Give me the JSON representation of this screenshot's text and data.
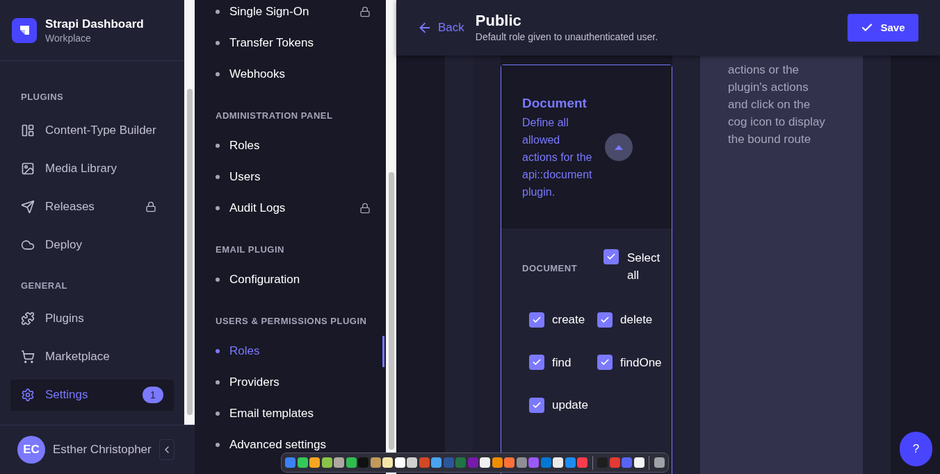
{
  "sidebar": {
    "brand": {
      "title": "Strapi Dashboard",
      "subtitle": "Workplace"
    },
    "sections": [
      {
        "heading": "PLUGINS",
        "items": [
          {
            "label": "Content-Type Builder",
            "selected": false,
            "locked": false
          },
          {
            "label": "Media Library",
            "selected": false,
            "locked": false
          },
          {
            "label": "Releases",
            "selected": false,
            "locked": true
          },
          {
            "label": "Deploy",
            "selected": false,
            "locked": false
          }
        ]
      },
      {
        "heading": "GENERAL",
        "items": [
          {
            "label": "Plugins",
            "selected": false,
            "locked": false
          },
          {
            "label": "Marketplace",
            "selected": false,
            "locked": false
          },
          {
            "label": "Settings",
            "selected": true,
            "locked": false,
            "badge": "1"
          }
        ]
      }
    ],
    "user": {
      "initials": "EC",
      "name": "Esther Christopher"
    }
  },
  "settings_nav": {
    "groups": [
      {
        "items": [
          {
            "label": "Single Sign-On",
            "selected": false,
            "locked": true
          },
          {
            "label": "Transfer Tokens",
            "selected": false,
            "locked": false
          },
          {
            "label": "Webhooks",
            "selected": false,
            "locked": false
          }
        ]
      },
      {
        "heading": "ADMINISTRATION PANEL",
        "items": [
          {
            "label": "Roles",
            "selected": false,
            "locked": false
          },
          {
            "label": "Users",
            "selected": false,
            "locked": false
          },
          {
            "label": "Audit Logs",
            "selected": false,
            "locked": true
          }
        ]
      },
      {
        "heading": "EMAIL PLUGIN",
        "items": [
          {
            "label": "Configuration",
            "selected": false,
            "locked": false
          }
        ]
      },
      {
        "heading": "USERS & PERMISSIONS PLUGIN",
        "items": [
          {
            "label": "Roles",
            "selected": true,
            "locked": false
          },
          {
            "label": "Providers",
            "selected": false,
            "locked": false
          },
          {
            "label": "Email templates",
            "selected": false,
            "locked": false
          },
          {
            "label": "Advanced settings",
            "selected": false,
            "locked": false
          }
        ]
      }
    ]
  },
  "header": {
    "back": "Back",
    "title": "Public",
    "subtitle": "Default role given to unauthenticated user.",
    "save": "Save"
  },
  "permissions_card": {
    "title": "Document",
    "description": "Define all allowed actions for the api::document plugin.",
    "expanded": true,
    "section_label": "DOCUMENT",
    "select_all": {
      "label": "Select all",
      "checked": true
    },
    "actions": [
      {
        "label": "create",
        "checked": true
      },
      {
        "label": "delete",
        "checked": true
      },
      {
        "label": "find",
        "checked": true
      },
      {
        "label": "findOne",
        "checked": true
      },
      {
        "label": "update",
        "checked": true
      }
    ]
  },
  "info_panel": {
    "text": "actions or the plugin's actions and click on the cog icon to display the bound route"
  },
  "help_button": "?",
  "dock": {
    "items": [
      {
        "kind": "app",
        "color": "#3b82f6"
      },
      {
        "kind": "app",
        "color": "#34c759"
      },
      {
        "kind": "app",
        "color": "#f5a623"
      },
      {
        "kind": "app",
        "color": "#8bc34a"
      },
      {
        "kind": "app",
        "color": "#b0a8a0"
      },
      {
        "kind": "app",
        "color": "#2fbf4f"
      },
      {
        "kind": "app",
        "color": "#111111"
      },
      {
        "kind": "app",
        "color": "#c19a5b"
      },
      {
        "kind": "app",
        "color": "#f5e6a8"
      },
      {
        "kind": "app",
        "color": "#ffffff"
      },
      {
        "kind": "app",
        "color": "#d0d0d0"
      },
      {
        "kind": "app",
        "color": "#d24726"
      },
      {
        "kind": "app",
        "color": "#4aa3f0"
      },
      {
        "kind": "app",
        "color": "#2b579a"
      },
      {
        "kind": "app",
        "color": "#217346"
      },
      {
        "kind": "app",
        "color": "#7719aa"
      },
      {
        "kind": "app",
        "color": "#f0f0f0"
      },
      {
        "kind": "app",
        "color": "#f08c00"
      },
      {
        "kind": "app",
        "color": "#ff7139"
      },
      {
        "kind": "app",
        "color": "#8e8e93"
      },
      {
        "kind": "app",
        "color": "#9b59f6"
      },
      {
        "kind": "app",
        "color": "#0078d4"
      },
      {
        "kind": "app",
        "color": "#eaeaea"
      },
      {
        "kind": "app",
        "color": "#1c8cf2"
      },
      {
        "kind": "app",
        "color": "#fa3c4c"
      },
      {
        "kind": "separator"
      },
      {
        "kind": "app",
        "color": "#1e1e1e"
      },
      {
        "kind": "app",
        "color": "#e53935"
      },
      {
        "kind": "app",
        "color": "#5865f2"
      },
      {
        "kind": "app",
        "color": "#f5f5f5"
      },
      {
        "kind": "separator"
      },
      {
        "kind": "app",
        "color": "#9ea3a8"
      }
    ]
  }
}
